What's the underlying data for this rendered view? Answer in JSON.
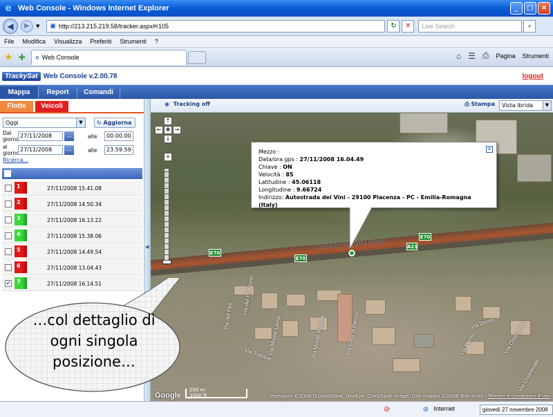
{
  "window": {
    "title": "Web Console - Windows Internet Explorer",
    "url": "http://213.215.219.58/tracker.aspx#r105",
    "search_placeholder": "Live Search",
    "buttons": [
      "_",
      "□",
      "×"
    ]
  },
  "menu": [
    "File",
    "Modifica",
    "Visualizza",
    "Preferiti",
    "Strumenti",
    "?"
  ],
  "tab": {
    "label": "Web Console"
  },
  "commandbar": {
    "page": "Pagina",
    "tools": "Strumenti"
  },
  "app": {
    "brand": "TrackySat",
    "title": "Web Console v.2.00.78",
    "logout": "logout",
    "main_tabs": [
      "Mappa",
      "Report",
      "Comandi"
    ],
    "sub_tabs": [
      "Flotte",
      "Veicoli"
    ]
  },
  "filters": {
    "period": "Oggi",
    "refresh": "Aggiorna",
    "from_label": "Dal giorno",
    "from_date": "27/11/2008",
    "from_time_label": "alle",
    "from_time": "00.00.00",
    "to_label": "al giorno",
    "to_date": "27/11/2008",
    "to_time_label": "alle",
    "to_time": "23.59.59",
    "search_link": "Ricerca..."
  },
  "vehicles": [
    {
      "num": "1",
      "color": "red",
      "time": "27/11/2008 15.41.08",
      "checked": false
    },
    {
      "num": "2",
      "color": "red",
      "time": "27/11/2008 14.50.34",
      "checked": false
    },
    {
      "num": "3",
      "color": "green",
      "time": "27/11/2008 16.13.22",
      "checked": false
    },
    {
      "num": "4",
      "color": "green",
      "time": "27/11/2008 15.38.06",
      "checked": false
    },
    {
      "num": "5",
      "color": "red",
      "time": "27/11/2008 14.49.54",
      "checked": false
    },
    {
      "num": "6",
      "color": "red",
      "time": "27/11/2008 13.04.43",
      "checked": false
    },
    {
      "num": "7",
      "color": "green",
      "time": "27/11/2008 16.14.51",
      "checked": true
    }
  ],
  "maptoolbar": {
    "tracking": "Tracking off",
    "print": "Stampa",
    "map_type": "Vista ibrida"
  },
  "infowindow": {
    "rows": [
      {
        "label": "Mezzo :",
        "value": ""
      },
      {
        "label": "Data/ora gps :",
        "value": "27/11/2008 16.04.49"
      },
      {
        "label": "Chiave :",
        "value": "ON"
      },
      {
        "label": "Velocità :",
        "value": "85"
      },
      {
        "label": "Latitudine :",
        "value": "45.06118"
      },
      {
        "label": "Longitudine :",
        "value": "9.66724"
      },
      {
        "label": "Indirizzo:",
        "value": "Autostrada dei Vini - 29100 Piacenza - PC - Emilia-Romagna (Italy)"
      }
    ]
  },
  "map_labels": {
    "highway": "Autostrada Piacenza-Brescia",
    "e70_a": "E70",
    "e70_b": "E70",
    "e70_c": "E70",
    "a21": "A21",
    "streets": [
      "Via del Poligono",
      "Via dei Pini",
      "Via Monte Lama",
      "Via Monte Ragola",
      "Via Città di Pierno",
      "Via Trebbia",
      "Via Dorsa",
      "Via Piemo",
      "Via Chiaravalle",
      "Via Chiaravaile"
    ],
    "scale_m": "200 m",
    "scale_ft": "1000 ft",
    "google": "Google",
    "attribution": "Immagini ©2008 DigitalGlobe, GeoEye, Cnes/Spot Image, Dati mappa ©2008 Tele Atlas -",
    "terms": "Termini e condizioni d'uso"
  },
  "callout": {
    "line1": "…col dettaglio di",
    "line2": "ogni singola",
    "line3": "posizione…"
  },
  "statusbar": {
    "zone": "Internet",
    "date": "giovedì 27 novembre 2008"
  }
}
